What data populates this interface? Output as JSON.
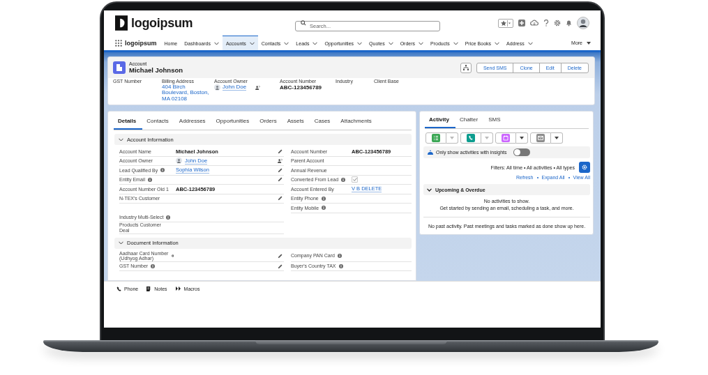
{
  "header": {
    "logo": "logoipsum",
    "search_placeholder": "Search..."
  },
  "nav": {
    "app_name": "logoipsum",
    "more": "More",
    "items": [
      {
        "label": "Home",
        "selected": false,
        "dropdown": false
      },
      {
        "label": "Dashboards",
        "selected": false,
        "dropdown": true
      },
      {
        "label": "Accounts",
        "selected": true,
        "dropdown": true
      },
      {
        "label": "Contacts",
        "selected": false,
        "dropdown": true
      },
      {
        "label": "Leads",
        "selected": false,
        "dropdown": true
      },
      {
        "label": "Opportunities",
        "selected": false,
        "dropdown": true
      },
      {
        "label": "Quotes",
        "selected": false,
        "dropdown": true
      },
      {
        "label": "Orders",
        "selected": false,
        "dropdown": true
      },
      {
        "label": "Products",
        "selected": false,
        "dropdown": true
      },
      {
        "label": "Price Books",
        "selected": false,
        "dropdown": true
      },
      {
        "label": "Address",
        "selected": false,
        "dropdown": true
      }
    ]
  },
  "record": {
    "type": "Account",
    "name": "Michael Johnson",
    "actions": [
      "Send SMS",
      "Clone",
      "Edit",
      "Delete"
    ],
    "fields": [
      {
        "label": "GST Number",
        "kind": "text"
      },
      {
        "label": "Billing Address",
        "kind": "link",
        "value": "404 Birch Boulevard, Boston, MA 02108"
      },
      {
        "label": "Account Owner",
        "kind": "owner",
        "value": "John Doe"
      },
      {
        "label": "Account Number",
        "kind": "text",
        "value": "ABC-123456789"
      },
      {
        "label": "Industry",
        "kind": "text"
      },
      {
        "label": "Client Base",
        "kind": "text"
      }
    ]
  },
  "details": {
    "tabs": [
      {
        "label": "Details",
        "selected": true
      },
      {
        "label": "Contacts",
        "selected": false
      },
      {
        "label": "Addresses",
        "selected": false
      },
      {
        "label": "Opportunities",
        "selected": false
      },
      {
        "label": "Orders",
        "selected": false
      },
      {
        "label": "Assets",
        "selected": false
      },
      {
        "label": "Cases",
        "selected": false
      },
      {
        "label": "Attachments",
        "selected": false
      }
    ],
    "sections": [
      {
        "title": "Account Information",
        "expanded": true,
        "rows": [
          {
            "left": {
              "label": "Account Name",
              "kind": "text",
              "value": "Michael Johnson",
              "info": false,
              "editable": true,
              "change_owner": false
            },
            "right": {
              "label": "Account Number",
              "kind": "text",
              "value": "ABC-123456789",
              "info": false,
              "editable": false,
              "change_owner": false
            }
          },
          {
            "left": {
              "label": "Account Owner",
              "kind": "owner",
              "value": "John Doe",
              "info": false,
              "editable": false,
              "change_owner": true
            },
            "right": {
              "label": "Parent Account",
              "kind": "text",
              "info": false,
              "editable": false,
              "change_owner": false
            }
          },
          {
            "left": {
              "label": "Lead Qualified By",
              "kind": "link",
              "value": "Sophia Wilson",
              "info": true,
              "editable": true,
              "change_owner": false
            },
            "right": {
              "label": "Annual Revenue",
              "kind": "text",
              "info": false,
              "editable": false,
              "change_owner": false
            }
          },
          {
            "left": {
              "label": "Entity Email",
              "kind": "text",
              "info": true,
              "editable": true,
              "change_owner": false
            },
            "right": {
              "label": "Converted From Lead",
              "kind": "checkbox",
              "checked": true,
              "info": true,
              "editable": false,
              "change_owner": false
            }
          },
          {
            "left": {
              "label": "Account Number Old 1",
              "kind": "text",
              "value": "ABC-123456789",
              "info": false,
              "editable": false,
              "change_owner": false
            },
            "right": {
              "label": "Account Entered By",
              "kind": "link",
              "value": "V B DELETE",
              "info": false,
              "editable": false,
              "change_owner": false
            }
          },
          {
            "left": {
              "label": "N-TEX's Customer",
              "kind": "text",
              "info": false,
              "editable": true,
              "change_owner": false
            },
            "right": {
              "label": "Entity Phone",
              "kind": "text",
              "info": true,
              "editable": false,
              "change_owner": false
            }
          },
          {
            "right": {
              "label": "Entity Mobile",
              "kind": "text",
              "info": true,
              "editable": false,
              "change_owner": false
            }
          },
          {
            "left": {
              "label": "Industry Multi-Select",
              "kind": "text",
              "info": true,
              "editable": false,
              "change_owner": false
            }
          },
          {
            "left": {
              "label": "Products Customer Deal",
              "kind": "text",
              "info": false,
              "editable": false,
              "change_owner": false
            }
          }
        ]
      },
      {
        "title": "Document Information",
        "expanded": true,
        "rows": [
          {
            "left": {
              "label": "Aadhaar Card Number (Udhyog Adhar)",
              "kind": "text",
              "info": true,
              "editable": true,
              "change_owner": false
            },
            "right": {
              "label": "Company PAN Card",
              "kind": "text",
              "info": true,
              "editable": false,
              "change_owner": false
            }
          },
          {
            "left": {
              "label": "GST Number",
              "kind": "text",
              "info": true,
              "editable": true,
              "change_owner": false
            },
            "right": {
              "label": "Buyer's Country TAX",
              "kind": "text",
              "info": true,
              "editable": false,
              "change_owner": false
            }
          }
        ]
      }
    ]
  },
  "activity": {
    "tabs": [
      {
        "label": "Activity",
        "selected": true
      },
      {
        "label": "Chatter",
        "selected": false
      },
      {
        "label": "SMS",
        "selected": false
      }
    ],
    "actions": [
      {
        "kind": "task",
        "color": "#3ba755",
        "menu_disabled": true
      },
      {
        "kind": "call",
        "color": "#0d9d8f",
        "menu_disabled": true
      },
      {
        "kind": "event",
        "color": "#cb65ff",
        "menu_disabled": false
      },
      {
        "kind": "email",
        "color": "#8c8c8c",
        "menu_disabled": false
      }
    ],
    "insights": {
      "label": "Only show activities with insights",
      "on": false
    },
    "filters": "Filters: All time • All activities • All types",
    "links": [
      "Refresh",
      "Expand All",
      "View All"
    ],
    "section": {
      "title": "Upcoming & Overdue",
      "expanded": true,
      "empty_title": "No activities to show.",
      "empty_text": "Get started by sending an email, scheduling a task, and more."
    },
    "past": "No past activity. Past meetings and tasks marked as done show up here."
  },
  "utility": [
    {
      "kind": "phone",
      "label": "Phone"
    },
    {
      "kind": "notes",
      "label": "Notes"
    },
    {
      "kind": "macros",
      "label": "Macros"
    }
  ]
}
